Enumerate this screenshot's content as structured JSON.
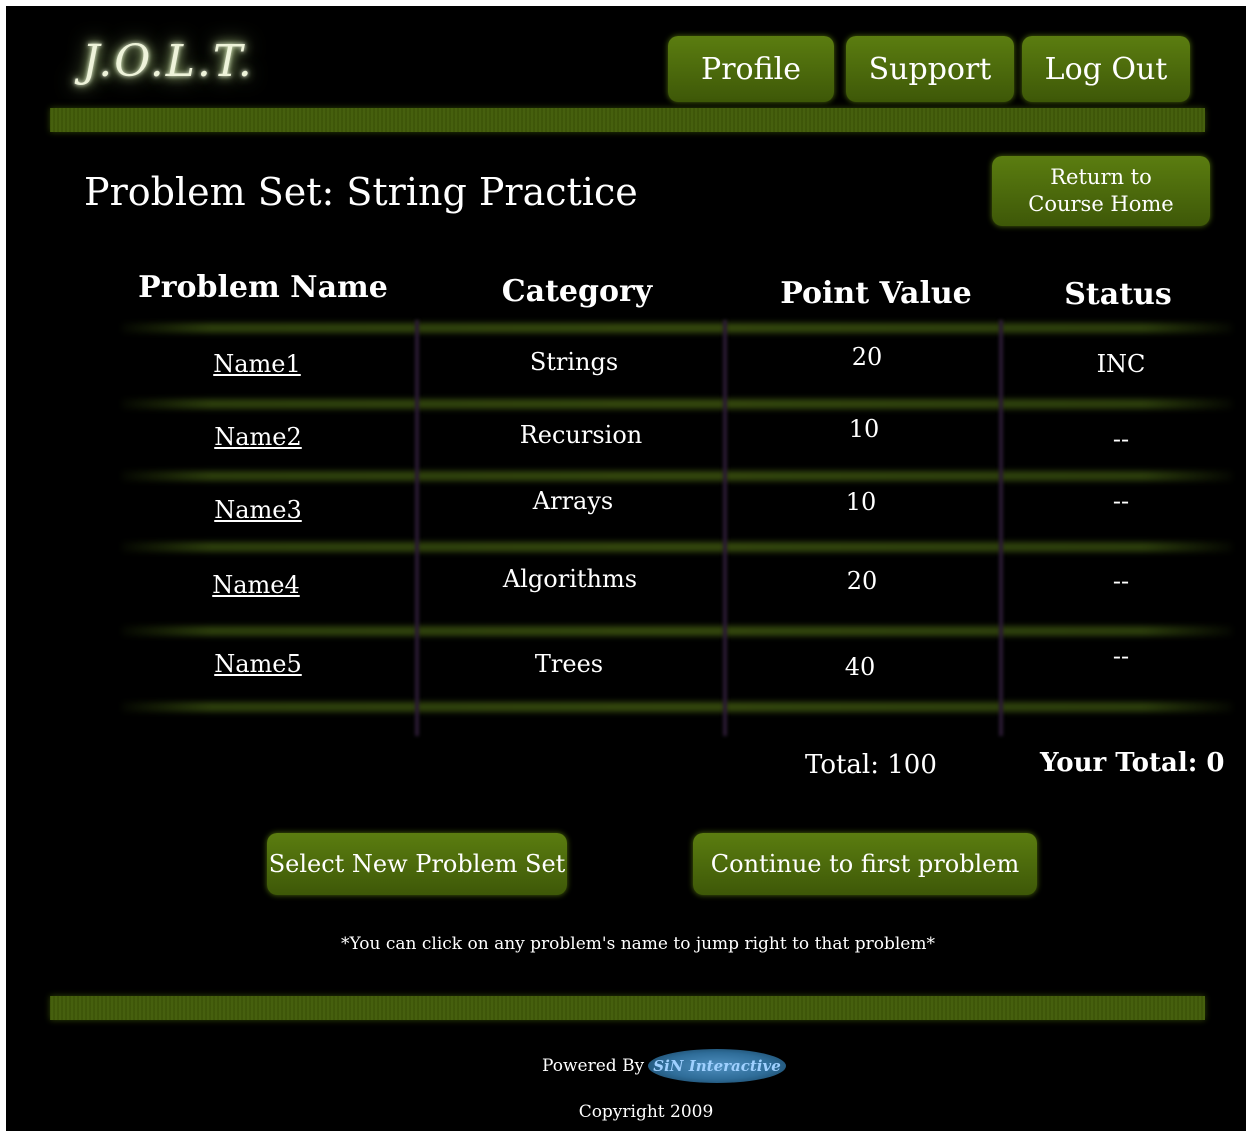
{
  "header": {
    "logo": "J.O.L.T.",
    "nav": [
      "Profile",
      "Support",
      "Log Out"
    ]
  },
  "page": {
    "title": "Problem Set: String Practice",
    "return_label": "Return to Course Home"
  },
  "table": {
    "columns": [
      "Problem Name",
      "Category",
      "Point Value",
      "Status"
    ],
    "rows": [
      {
        "name": "Name1",
        "category": "Strings",
        "points": "20",
        "status": "INC"
      },
      {
        "name": "Name2",
        "category": "Recursion",
        "points": "10",
        "status": "--"
      },
      {
        "name": "Name3",
        "category": "Arrays",
        "points": "10",
        "status": "--"
      },
      {
        "name": "Name4",
        "category": "Algorithms",
        "points": "20",
        "status": "--"
      },
      {
        "name": "Name5",
        "category": "Trees",
        "points": "40",
        "status": "--"
      }
    ],
    "total": "Total: 100",
    "your_total": "Your Total: 0"
  },
  "actions": {
    "select_new": "Select New Problem Set",
    "continue": "Continue to first problem"
  },
  "note": "*You can click on any problem's name to jump right to that problem*",
  "footer": {
    "powered_by": "Powered By",
    "badge": "SiN Interactive",
    "copyright": "Copyright 2009"
  },
  "colors": {
    "button": "#4a6a0c",
    "bar": "#3b5207",
    "background": "#000000"
  }
}
